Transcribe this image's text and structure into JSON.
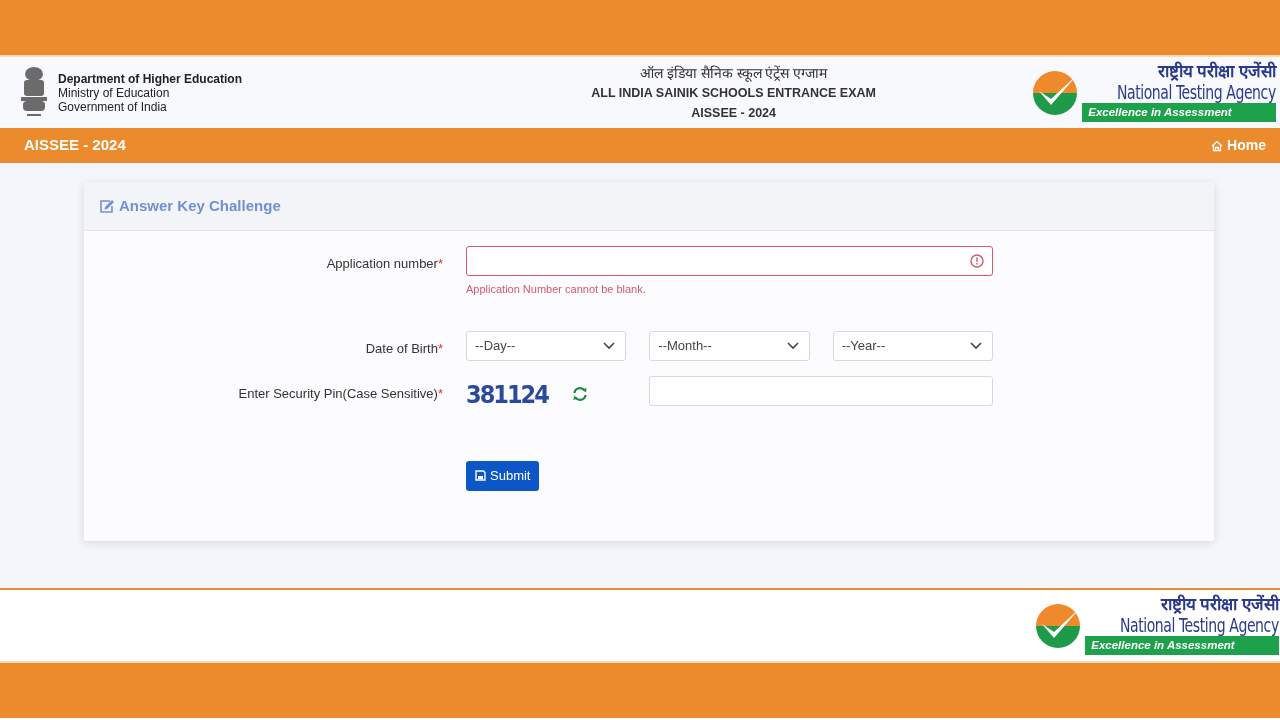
{
  "header": {
    "department": "Department of Higher Education",
    "ministry": "Ministry of Education",
    "government": "Government of India",
    "title_hindi": "ऑल इंडिया सैनिक स्कूल एंट्रेंस एग्जाम",
    "title": "ALL INDIA SAINIK SCHOOLS ENTRANCE EXAM",
    "subtitle": "AISSEE - 2024",
    "agency_logo": {
      "hindi": "राष्ट्रीय परीक्षा एजेंसी",
      "name": "National Testing Agency",
      "tagline": "Excellence in Assessment"
    }
  },
  "navbar": {
    "brand": "AISSEE - 2024",
    "home": "Home"
  },
  "form": {
    "title": "Answer Key Challenge",
    "fields": [
      {
        "kind": "text",
        "label": "Application number",
        "required_mark": "*",
        "invalid": true,
        "error": "Application Number cannot be blank."
      },
      {
        "kind": "date",
        "label": "Date of Birth",
        "required_mark": "*",
        "selects": [
          "--Day--",
          "--Month--",
          "--Year--"
        ]
      },
      {
        "kind": "captcha",
        "label": "Enter Security Pin(Case Sensitive)",
        "required_mark": "*",
        "captcha": "381124"
      }
    ],
    "submit": "Submit"
  },
  "footer": {
    "agency_logo": {
      "hindi": "राष्ट्रीय परीक्षा एजेंसी",
      "name": "National Testing Agency",
      "tagline": "Excellence in Assessment"
    }
  }
}
